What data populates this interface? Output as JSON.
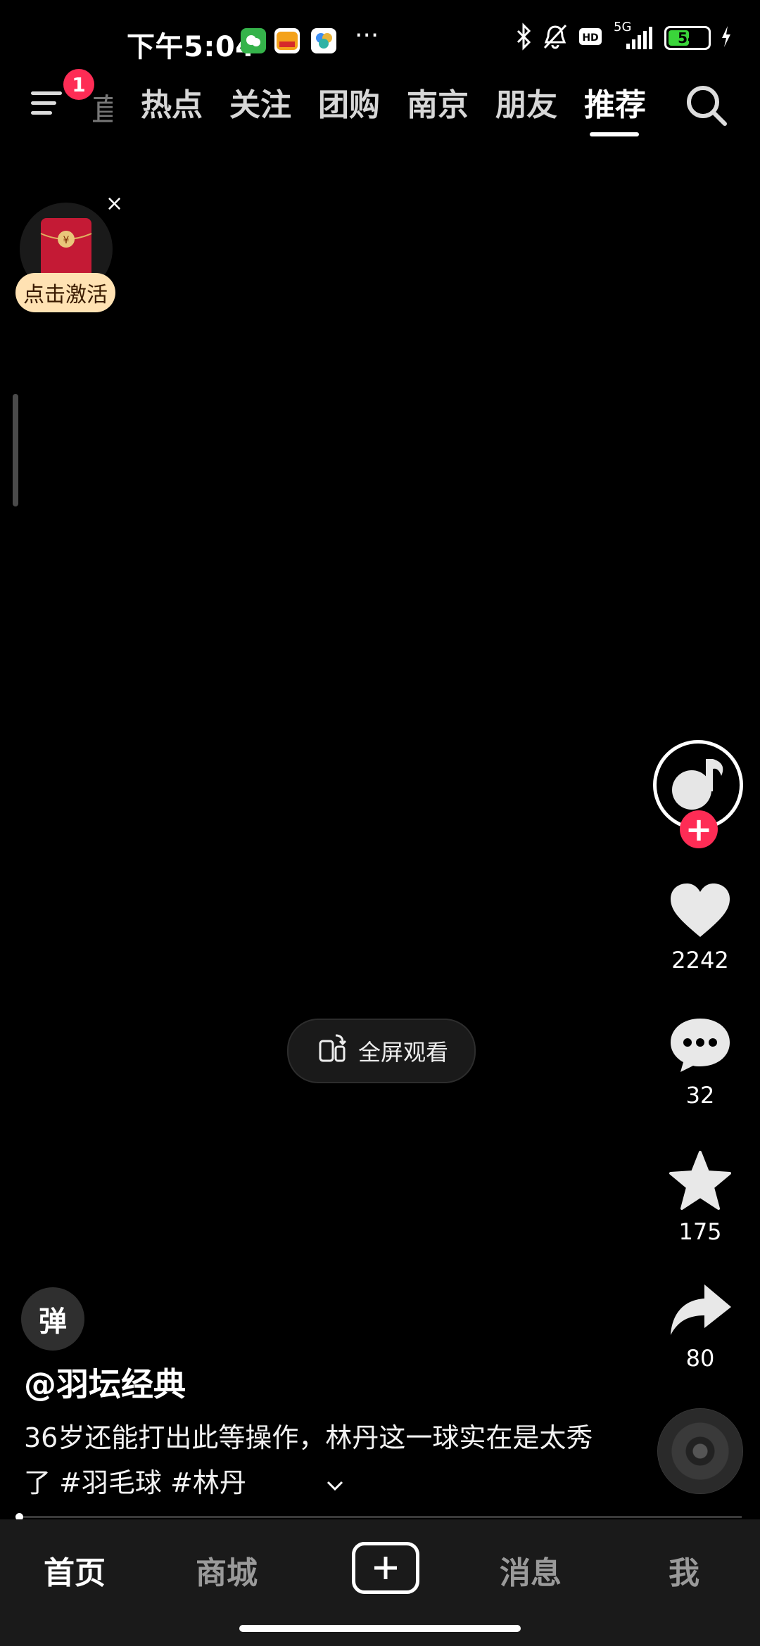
{
  "status_bar": {
    "time": "下午5:04",
    "more": "···",
    "network": "5G",
    "battery_level": 54,
    "battery_text": "54",
    "notifications_muted": true
  },
  "top_nav": {
    "menu_badge": "1",
    "partial_tab": "直",
    "tabs": [
      {
        "label": "热点",
        "active": false
      },
      {
        "label": "关注",
        "active": false
      },
      {
        "label": "团购",
        "active": false
      },
      {
        "label": "南京",
        "active": false
      },
      {
        "label": "朋友",
        "active": false
      },
      {
        "label": "推荐",
        "active": true
      }
    ]
  },
  "red_packet": {
    "label": "点击激活",
    "close": "×"
  },
  "fullscreen": {
    "label": "全屏观看"
  },
  "actions": {
    "like_count": "2242",
    "comment_count": "32",
    "favorite_count": "175",
    "share_count": "80"
  },
  "video_info": {
    "danmaku_label": "弹",
    "author": "@羽坛经典",
    "description": "36岁还能打出此等操作，林丹这一球实在是太秀了 #羽毛球 #林丹"
  },
  "playback": {
    "progress": 0.0
  },
  "bottom_nav": {
    "items": [
      {
        "label": "首页",
        "active": true
      },
      {
        "label": "商城",
        "active": false
      },
      {
        "label": "消息",
        "active": false
      },
      {
        "label": "我",
        "active": false
      }
    ]
  },
  "colors": {
    "accent": "#fe2c55",
    "background": "#000000",
    "nav_background": "#1a1a1a"
  }
}
